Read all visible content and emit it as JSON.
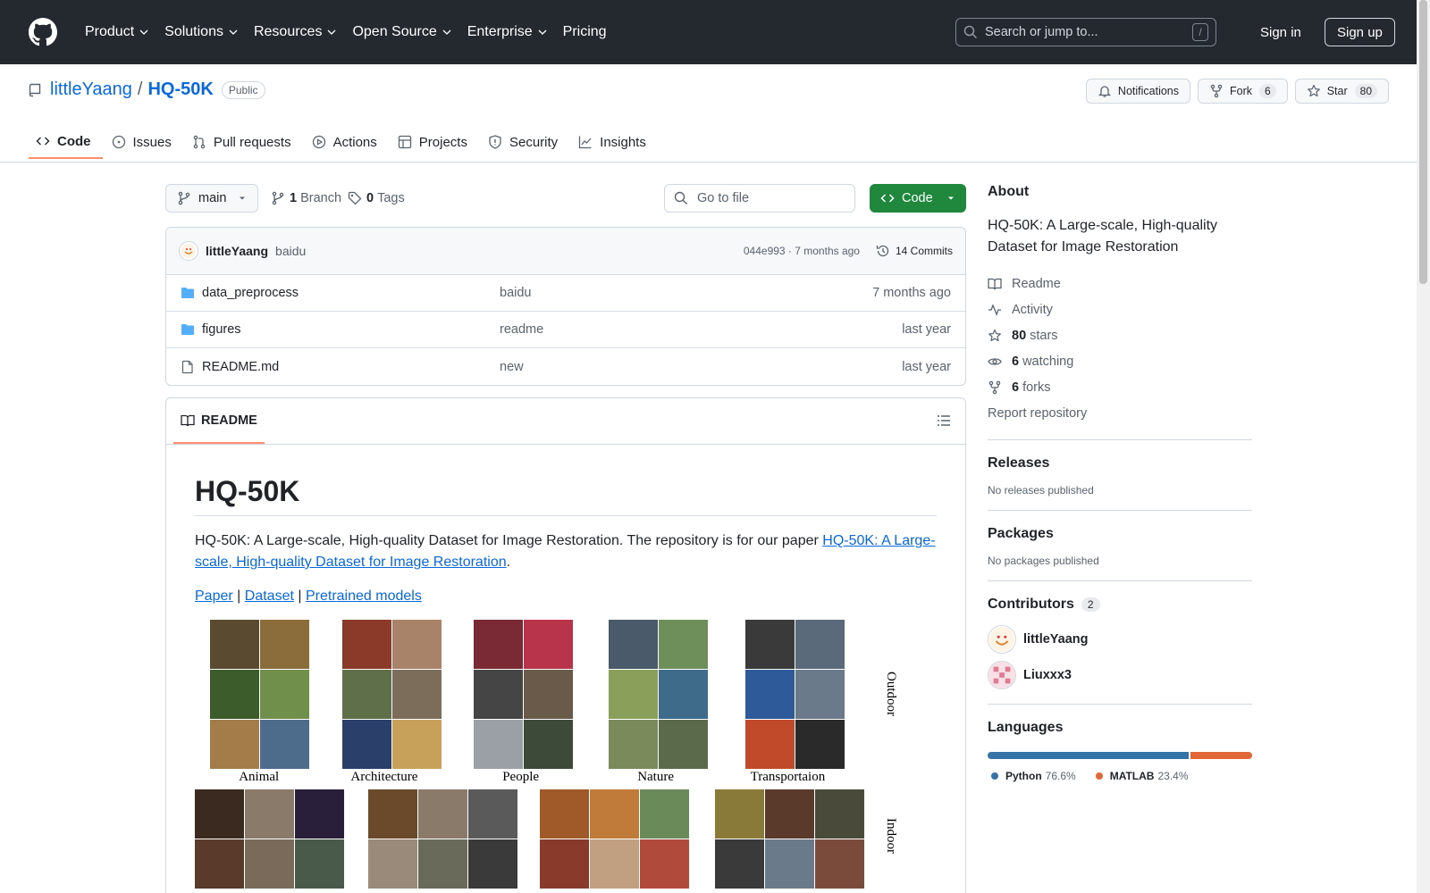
{
  "header": {
    "nav": [
      "Product",
      "Solutions",
      "Resources",
      "Open Source",
      "Enterprise",
      "Pricing"
    ],
    "search_placeholder": "Search or jump to...",
    "search_shortcut": "/",
    "sign_in": "Sign in",
    "sign_up": "Sign up"
  },
  "repo": {
    "owner": "littleYaang",
    "separator": "/",
    "name": "HQ-50K",
    "visibility": "Public",
    "notifications_label": "Notifications",
    "fork_label": "Fork",
    "fork_count": "6",
    "star_label": "Star",
    "star_count": "80"
  },
  "tabs": [
    "Code",
    "Issues",
    "Pull requests",
    "Actions",
    "Projects",
    "Security",
    "Insights"
  ],
  "toolbar": {
    "branch": "main",
    "branch_count": "1",
    "branch_label": "Branch",
    "tag_count": "0",
    "tag_label": "Tags",
    "goto_placeholder": "Go to file",
    "code_button": "Code"
  },
  "commit": {
    "author": "littleYaang",
    "message": "baidu",
    "hash_time": "044e993 · 7 months ago",
    "commits": "14 Commits"
  },
  "files": [
    {
      "name": "data_preprocess",
      "type": "folder",
      "message": "baidu",
      "date": "7 months ago"
    },
    {
      "name": "figures",
      "type": "folder",
      "message": "readme",
      "date": "last year"
    },
    {
      "name": "README.md",
      "type": "file",
      "message": "new",
      "date": "last year"
    }
  ],
  "readme": {
    "tab_label": "README",
    "title": "HQ-50K",
    "intro": "HQ-50K: A Large-scale, High-quality Dataset for Image Restoration. The repository is for our paper ",
    "paper_link": "HQ-50K: A Large-scale, High-quality Dataset for Image Restoration",
    "intro_end": ".",
    "links": [
      "Paper",
      "Dataset",
      "Pretrained models"
    ],
    "link_sep": "|",
    "figure_categories_outdoor": [
      "Animal",
      "Architecture",
      "People",
      "Nature",
      "Transportaion"
    ],
    "figure_side_outdoor": "Outdoor",
    "figure_side_indoor": "Indoor"
  },
  "about": {
    "title": "About",
    "description": "HQ-50K: A Large-scale, High-quality Dataset for Image Restoration",
    "readme": "Readme",
    "activity": "Activity",
    "stars_count": "80",
    "stars_label": "stars",
    "watching_count": "6",
    "watching_label": "watching",
    "forks_count": "6",
    "forks_label": "forks",
    "report": "Report repository"
  },
  "releases": {
    "title": "Releases",
    "empty": "No releases published"
  },
  "packages": {
    "title": "Packages",
    "empty": "No packages published"
  },
  "contributors": {
    "title": "Contributors",
    "count": "2",
    "people": [
      "littleYaang",
      "Liuxxx3"
    ]
  },
  "languages": {
    "title": "Languages",
    "items": [
      {
        "name": "Python",
        "pct": "76.6%",
        "value": 76.6,
        "color": "#3572A5"
      },
      {
        "name": "MATLAB",
        "pct": "23.4%",
        "value": 23.4,
        "color": "#e16737"
      }
    ]
  }
}
